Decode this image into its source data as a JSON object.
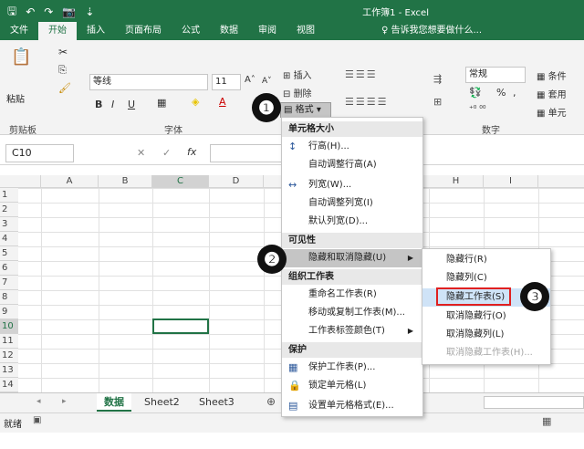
{
  "window": {
    "title": "工作簿1 - Excel"
  },
  "qat": {
    "save": "🖫",
    "undo": "↶",
    "redo": "↷",
    "camera": "📷",
    "more": "⇣"
  },
  "tabs": [
    "文件",
    "开始",
    "插入",
    "页面布局",
    "公式",
    "数据",
    "审阅",
    "视图"
  ],
  "active_tab": "开始",
  "tell_me": "♀ 告诉我您想要做什么...",
  "ribbon": {
    "paste": "粘贴",
    "clipboard_group": "剪贴板",
    "font_name": "等线",
    "font_size": "11",
    "font_group": "字体",
    "bold": "B",
    "italic": "I",
    "underline": "U",
    "grow": "A˄",
    "shrink": "A˅",
    "insert": "插入",
    "delete": "删除",
    "format": "格式",
    "number_format": "常规",
    "number_group": "数字",
    "percent": "%",
    "comma": ",",
    "cond_format": "条件",
    "table_format": "套用",
    "cell_style": "单元"
  },
  "formula_bar": {
    "name_box": "C10",
    "fx": "fx",
    "cancel": "✕",
    "enter": "✓"
  },
  "columns": [
    "A",
    "B",
    "C",
    "D",
    "H",
    "I"
  ],
  "rows": [
    "1",
    "2",
    "3",
    "4",
    "5",
    "6",
    "7",
    "8",
    "9",
    "10",
    "11",
    "12",
    "13",
    "14"
  ],
  "sheets": [
    "数据",
    "Sheet2",
    "Sheet3"
  ],
  "active_sheet": "数据",
  "status": {
    "ready": "就绪"
  },
  "menu": {
    "sections": {
      "size": "单元格大小",
      "visibility": "可见性",
      "organize": "组织工作表",
      "protect": "保护"
    },
    "items": {
      "row_height": "行高(H)...",
      "autofit_row": "自动调整行高(A)",
      "col_width": "列宽(W)...",
      "autofit_col": "自动调整列宽(I)",
      "default_width": "默认列宽(D)...",
      "hide_unhide": "隐藏和取消隐藏(U)",
      "rename": "重命名工作表(R)",
      "move_copy": "移动或复制工作表(M)...",
      "tab_color": "工作表标签颜色(T)",
      "protect_sheet": "保护工作表(P)...",
      "lock_cell": "锁定单元格(L)",
      "format_cells": "设置单元格格式(E)..."
    }
  },
  "submenu": {
    "hide_rows": "隐藏行(R)",
    "hide_cols": "隐藏列(C)",
    "hide_sheet": "隐藏工作表(S)",
    "unhide_rows": "取消隐藏行(O)",
    "unhide_cols": "取消隐藏列(L)",
    "unhide_sheet": "取消隐藏工作表(H)..."
  },
  "badges": [
    "❶",
    "❷",
    "❸"
  ],
  "colors": {
    "accent": "#217346",
    "highlight_box": "#e02020"
  }
}
